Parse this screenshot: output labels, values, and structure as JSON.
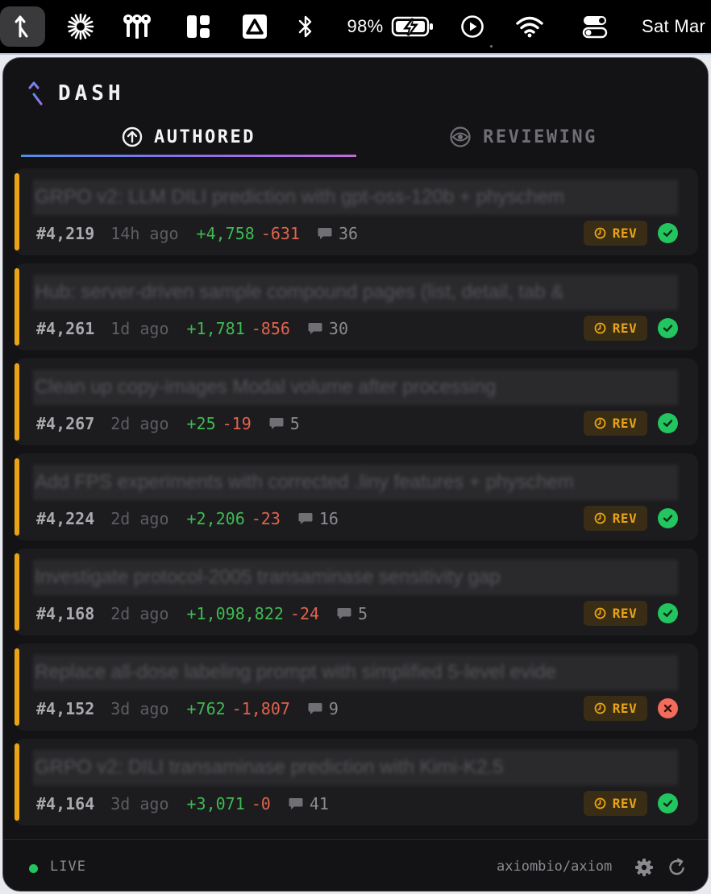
{
  "menubar": {
    "battery_percent": "98%",
    "clock": "Sat Mar",
    "icons": [
      "dash-app-icon",
      "sparkle-icon",
      "keys-icon",
      "layout-icon",
      "drive-icon",
      "bluetooth-icon",
      "battery-charging-icon",
      "play-icon",
      "wifi-icon",
      "control-center-icon"
    ]
  },
  "app": {
    "title": "DASH",
    "accent_color": "#e8a317",
    "success_color": "#22c55e",
    "error_color": "#f26b5b"
  },
  "tabs": [
    {
      "label": "AUTHORED",
      "icon": "arrow-up-circle-icon",
      "active": true
    },
    {
      "label": "REVIEWING",
      "icon": "eye-icon",
      "active": false
    }
  ],
  "prs": [
    {
      "title": "GRPO v2: LLM DILI prediction with gpt-oss-120b + physchem",
      "number": "#4,219",
      "age": "14h ago",
      "additions": "+4,758",
      "deletions": "-631",
      "comments": "36",
      "badge": "REV",
      "status": "pass"
    },
    {
      "title": "Hub: server-driven sample compound pages (list, detail, tab &",
      "number": "#4,261",
      "age": "1d ago",
      "additions": "+1,781",
      "deletions": "-856",
      "comments": "30",
      "badge": "REV",
      "status": "pass"
    },
    {
      "title": "Clean up copy-images Modal volume after processing",
      "number": "#4,267",
      "age": "2d ago",
      "additions": "+25",
      "deletions": "-19",
      "comments": "5",
      "badge": "REV",
      "status": "pass"
    },
    {
      "title": "Add FPS experiments with corrected .liny features + physchem",
      "number": "#4,224",
      "age": "2d ago",
      "additions": "+2,206",
      "deletions": "-23",
      "comments": "16",
      "badge": "REV",
      "status": "pass"
    },
    {
      "title": "Investigate protocol-2005 transaminase sensitivity gap",
      "number": "#4,168",
      "age": "2d ago",
      "additions": "+1,098,822",
      "deletions": "-24",
      "comments": "5",
      "badge": "REV",
      "status": "pass"
    },
    {
      "title": "Replace all-dose labeling prompt with simplified 5-level evide",
      "number": "#4,152",
      "age": "3d ago",
      "additions": "+762",
      "deletions": "-1,807",
      "comments": "9",
      "badge": "REV",
      "status": "fail"
    },
    {
      "title": "GRPO v2: DILI transaminase prediction with Kimi-K2.5",
      "number": "#4,164",
      "age": "3d ago",
      "additions": "+3,071",
      "deletions": "-0",
      "comments": "41",
      "badge": "REV",
      "status": "pass"
    }
  ],
  "footer": {
    "live_label": "LIVE",
    "repo": "axiombio/axiom"
  }
}
